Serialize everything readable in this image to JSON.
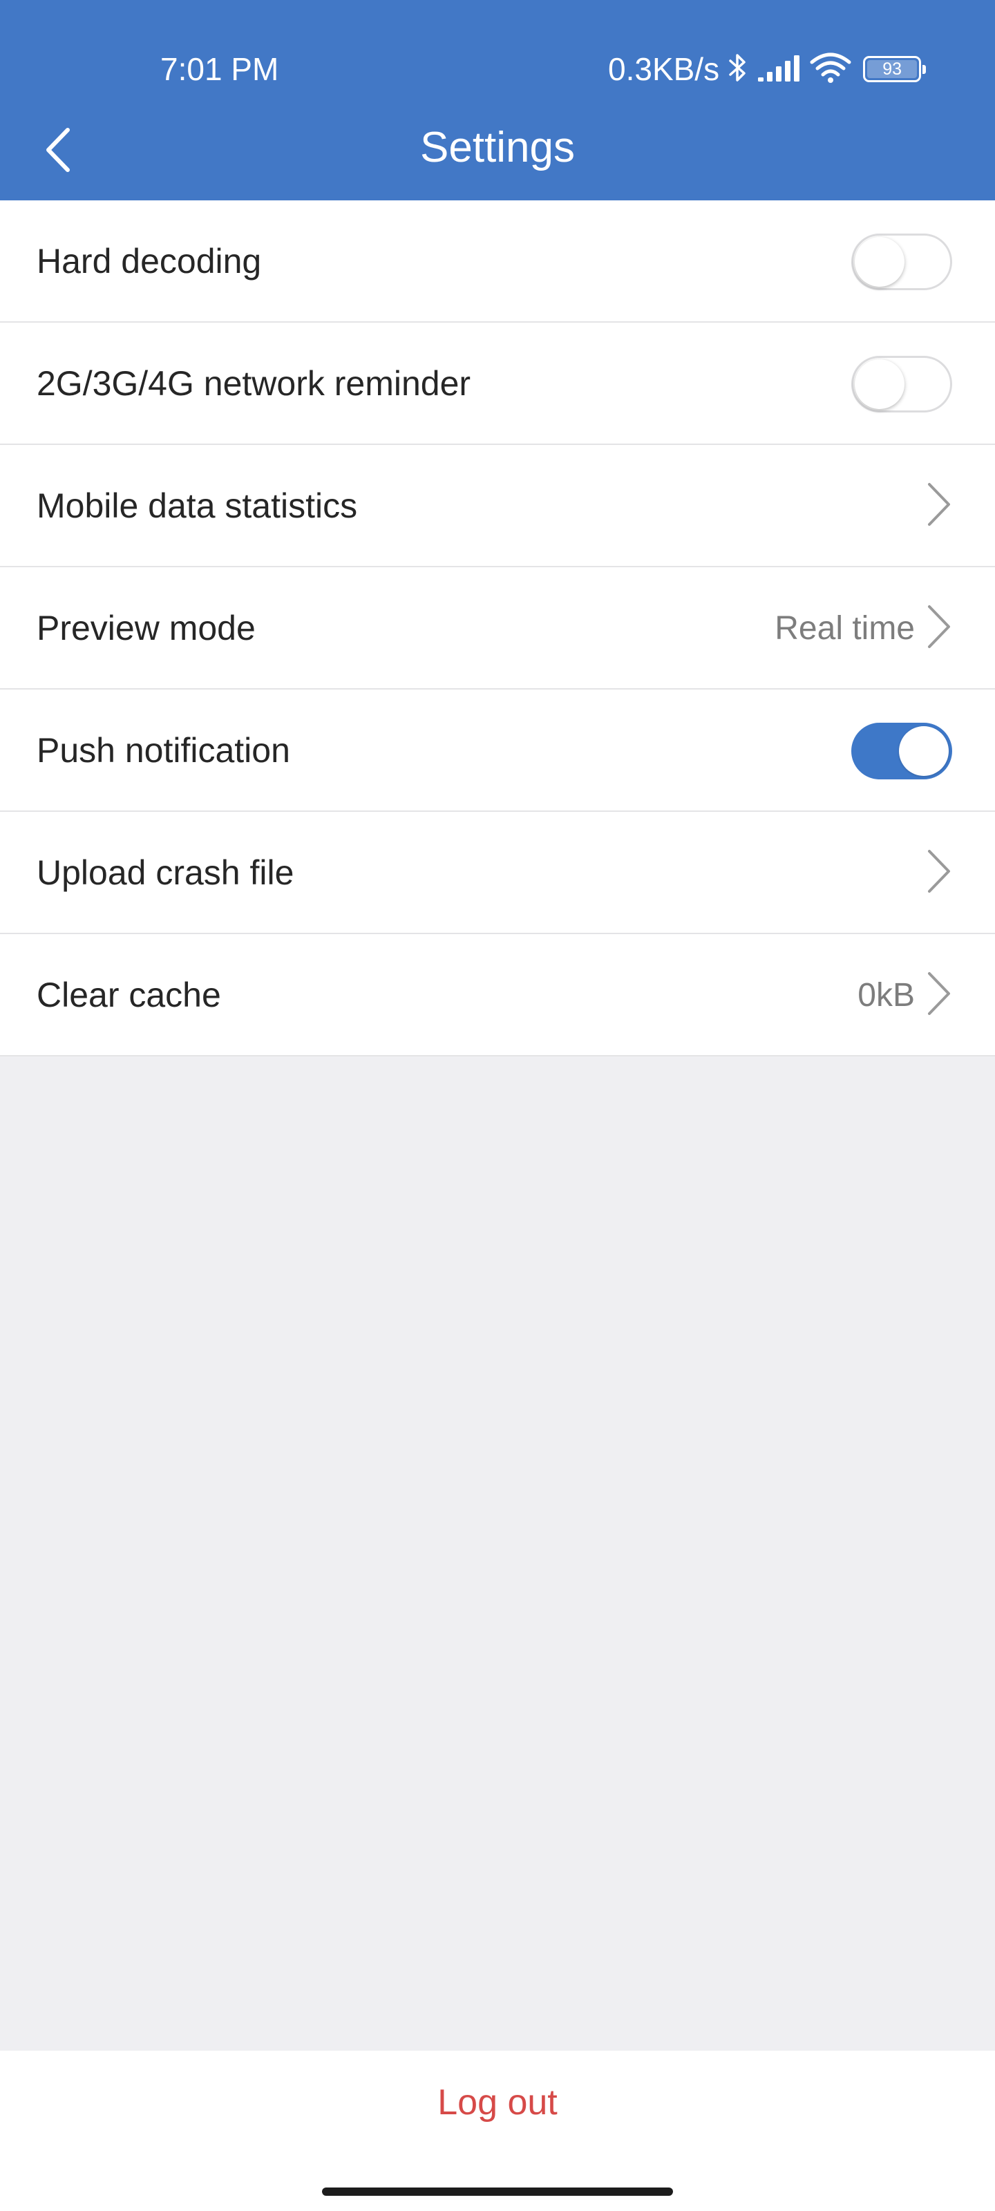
{
  "status_bar": {
    "time": "7:01 PM",
    "network_speed": "0.3KB/s",
    "icons": [
      "bluetooth-icon",
      "signal-icon",
      "wifi-icon",
      "battery-icon"
    ],
    "battery_level": "93"
  },
  "header": {
    "title": "Settings",
    "back_icon": "chevron-left-icon"
  },
  "settings": {
    "hard_decoding": {
      "label": "Hard decoding",
      "enabled": false
    },
    "network_reminder": {
      "label": "2G/3G/4G network reminder",
      "enabled": false
    },
    "mobile_data": {
      "label": "Mobile data statistics"
    },
    "preview_mode": {
      "label": "Preview mode",
      "value": "Real time"
    },
    "push_notification": {
      "label": "Push notification",
      "enabled": true
    },
    "upload_crash": {
      "label": "Upload crash file"
    },
    "clear_cache": {
      "label": "Clear cache",
      "value": "0kB"
    }
  },
  "footer": {
    "logout_label": "Log out"
  },
  "colors": {
    "header": "#4278c6",
    "toggle_on": "#3e78c8",
    "logout": "#d64a48",
    "background": "#efeff2"
  }
}
